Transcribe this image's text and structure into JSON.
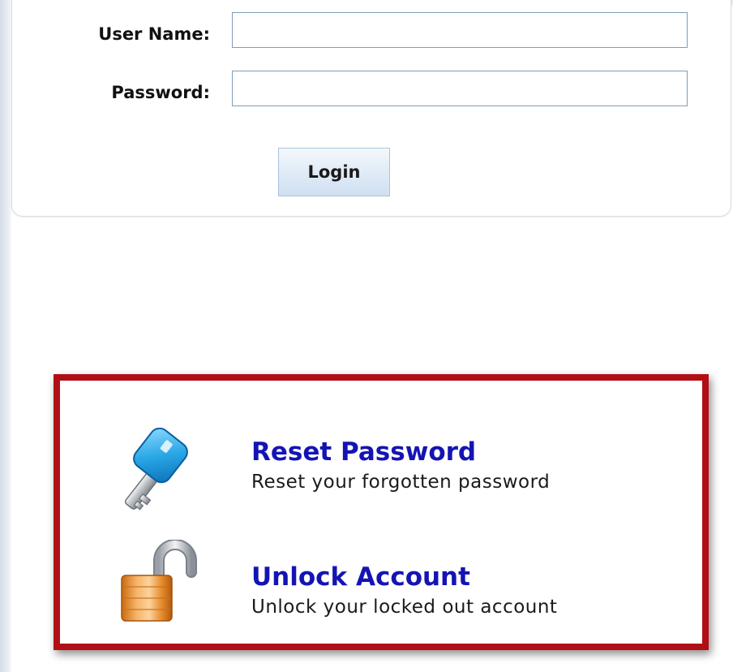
{
  "login": {
    "username_label": "User Name:",
    "username_value": "",
    "password_label": "Password:",
    "password_value": "",
    "login_button": "Login"
  },
  "recovery": {
    "options": [
      {
        "title": "Reset Password",
        "description": "Reset your forgotten password",
        "icon": "key-icon"
      },
      {
        "title": "Unlock Account",
        "description": "Unlock your locked out account",
        "icon": "padlock-open-icon"
      }
    ]
  },
  "colors": {
    "link": "#1414b4",
    "highlight_border": "#b00f16",
    "button_fill": "#dfeaf6"
  }
}
